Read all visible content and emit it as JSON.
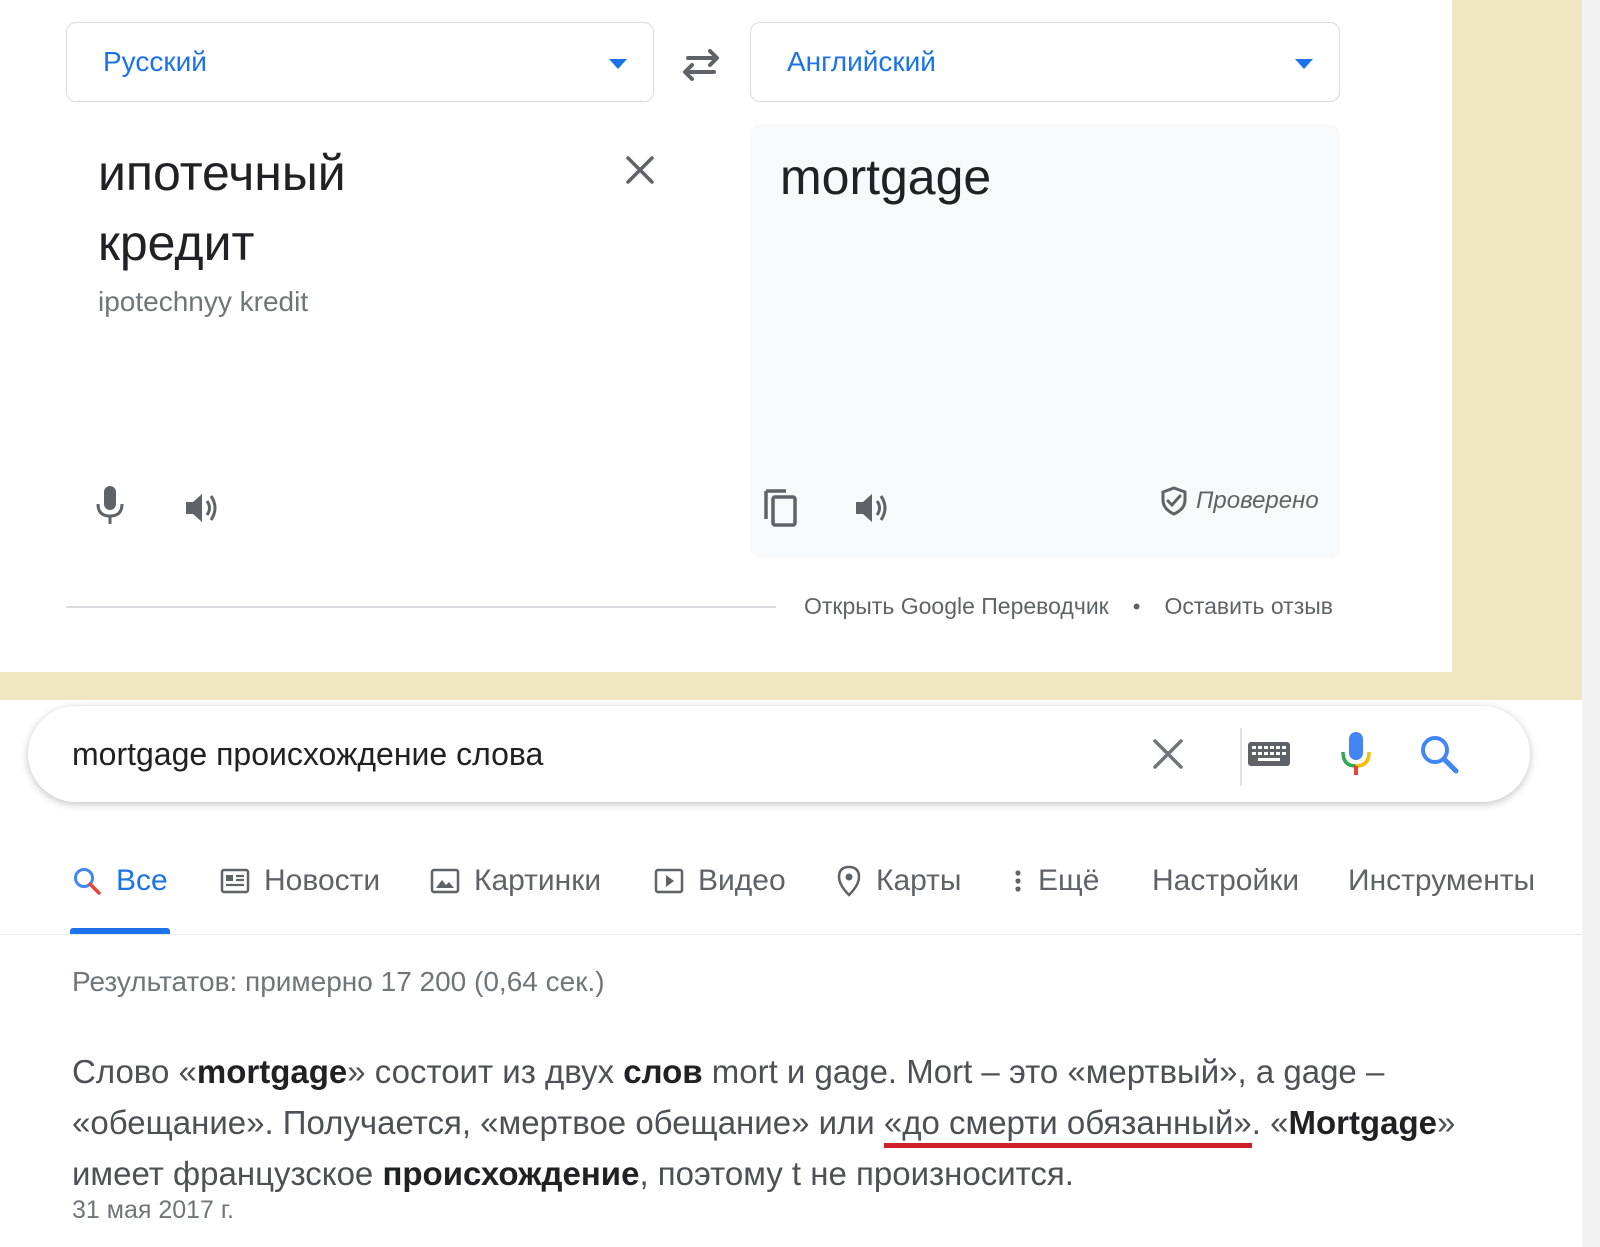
{
  "translator": {
    "source_language": "Русский",
    "target_language": "Английский",
    "source_text_line1": "ипотечный",
    "source_text_line2": "кредит",
    "transliteration": "ipotechnyy kredit",
    "translation": "mortgage",
    "verified_label": "Проверено",
    "open_translator_link": "Открыть Google Переводчик",
    "separator": "•",
    "feedback_link": "Оставить отзыв"
  },
  "search": {
    "query": "mortgage происхождение слова"
  },
  "tabs": [
    {
      "label": "Все",
      "icon": "search-icon",
      "active": true
    },
    {
      "label": "Новости",
      "icon": "news-icon"
    },
    {
      "label": "Картинки",
      "icon": "image-icon"
    },
    {
      "label": "Видео",
      "icon": "video-icon"
    },
    {
      "label": "Карты",
      "icon": "map-pin-icon"
    },
    {
      "label": "Ещё",
      "icon": "more-vert-icon"
    },
    {
      "label": "Настройки"
    },
    {
      "label": "Инструменты"
    }
  ],
  "results": {
    "stats": "Результатов: примерно 17 200 (0,64 сек.)",
    "snippet": {
      "p1": "Слово «",
      "b1": "mortgage",
      "p2": "» состоит из двух ",
      "b2": "слов",
      "p3": " mort и gage. Mort – это «мертвый», а gage – «обещание». Получается, «мертвое обещание» или ",
      "underlined": "«до смерти обязанный»",
      "p4": ". «",
      "b3": "Mortgage",
      "p5": "» имеет французское ",
      "b4": "происхождение",
      "p6": ", поэтому t не произносится."
    },
    "date": "31 мая 2017 г."
  },
  "colors": {
    "accent": "#1a73e8",
    "beige_background": "#f0e6c2",
    "highlight_underline": "#d0202b"
  }
}
